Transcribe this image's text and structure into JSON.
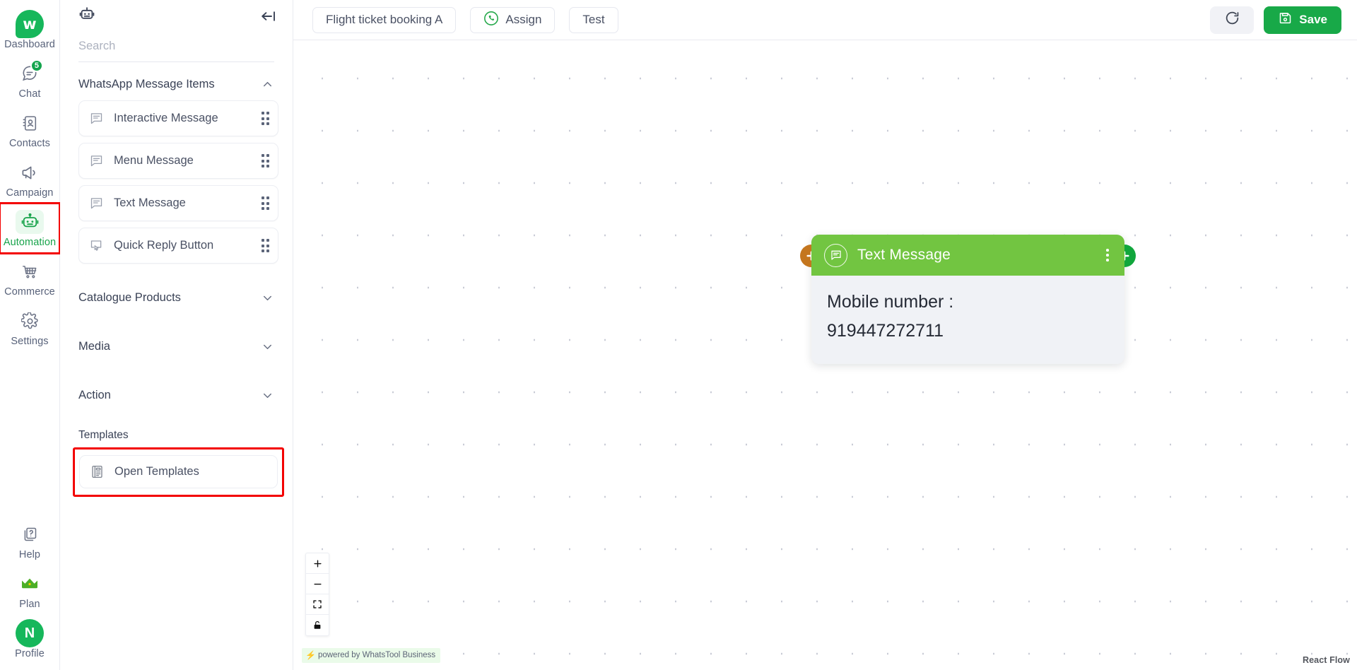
{
  "rail": {
    "top_items": [
      {
        "label": "Dashboard",
        "icon": "whatstool-logo-icon",
        "badge": null,
        "active": false
      },
      {
        "label": "Chat",
        "icon": "chat-bubble-icon",
        "badge": "5",
        "active": false
      },
      {
        "label": "Contacts",
        "icon": "contacts-book-icon",
        "badge": null,
        "active": false
      },
      {
        "label": "Campaign",
        "icon": "megaphone-icon",
        "badge": null,
        "active": false
      },
      {
        "label": "Automation",
        "icon": "robot-icon",
        "badge": null,
        "active": true
      },
      {
        "label": "Commerce",
        "icon": "shopping-cart-icon",
        "badge": null,
        "active": false
      },
      {
        "label": "Settings",
        "icon": "gear-icon",
        "badge": null,
        "active": false
      }
    ],
    "bottom_items": [
      {
        "label": "Help",
        "icon": "help-question-icon"
      },
      {
        "label": "Plan",
        "icon": "crown-icon"
      },
      {
        "label": "Profile",
        "icon": "avatar-icon",
        "initial": "N"
      }
    ],
    "logo_letter": "w",
    "active_highlight_color": "#f30000",
    "accent_color": "#17a34a"
  },
  "panel": {
    "header_icon": "robot-icon",
    "collapse_icon": "collapse-left-icon",
    "search": {
      "value": "",
      "placeholder": "Search"
    },
    "groups": [
      {
        "title": "WhatsApp Message Items",
        "expanded": true,
        "chevron": "chevron-up-icon",
        "items": [
          {
            "label": "Interactive Message",
            "icon": "message-lines-icon"
          },
          {
            "label": "Menu Message",
            "icon": "message-lines-icon"
          },
          {
            "label": "Text Message",
            "icon": "message-lines-icon"
          },
          {
            "label": "Quick Reply Button",
            "icon": "quick-reply-icon"
          }
        ]
      },
      {
        "title": "Catalogue Products",
        "expanded": false,
        "chevron": "chevron-down-icon",
        "items": []
      },
      {
        "title": "Media",
        "expanded": false,
        "chevron": "chevron-down-icon",
        "items": []
      },
      {
        "title": "Action",
        "expanded": false,
        "chevron": "chevron-down-icon",
        "items": []
      }
    ],
    "templates": {
      "title": "Templates",
      "item": {
        "label": "Open Templates",
        "icon": "template-document-icon"
      },
      "highlight_color": "#f30000"
    }
  },
  "topbar": {
    "flow_name": "Flight ticket booking A",
    "assign_label": "Assign",
    "assign_icon": "whatsapp-icon",
    "test_label": "Test",
    "refresh_icon": "refresh-icon",
    "save_label": "Save",
    "save_icon": "floppy-disk-icon",
    "save_color": "#18a948"
  },
  "canvas": {
    "node": {
      "title": "Text Message",
      "title_icon": "message-lines-icon",
      "header_color": "#72c541",
      "menu_icon": "kebab-menu-icon",
      "body_lines": [
        "Mobile number :",
        "919447272711"
      ],
      "left_handle": {
        "icon": "plus-icon",
        "color": "#c4761e"
      },
      "right_handle": {
        "icon": "plus-icon",
        "color": "#11a63c"
      }
    },
    "controls": [
      {
        "name": "zoom-in",
        "icon": "plus-icon"
      },
      {
        "name": "zoom-out",
        "icon": "minus-icon"
      },
      {
        "name": "fit-view",
        "icon": "fit-view-icon"
      },
      {
        "name": "toggle-interactivity",
        "icon": "unlock-icon"
      }
    ],
    "attribution": "powered by WhatsTool Business",
    "watermark": "React Flow"
  }
}
